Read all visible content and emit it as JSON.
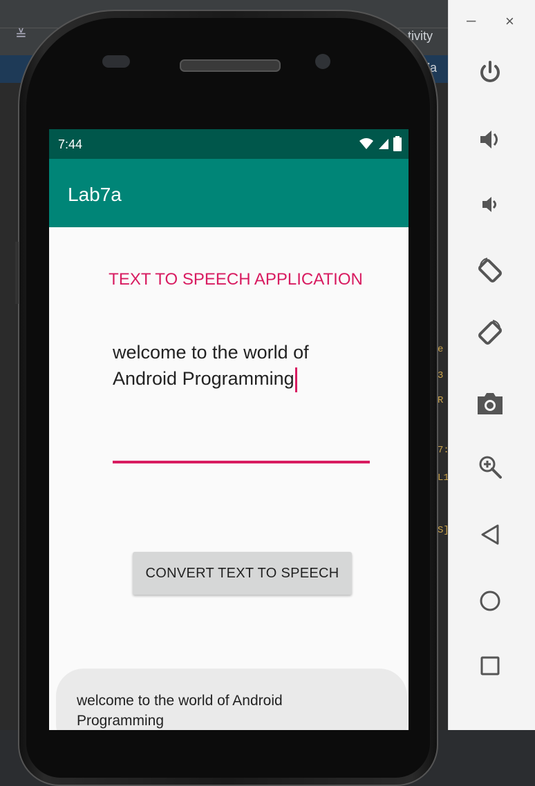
{
  "ide": {
    "tab_partial": "tivity",
    "tab_partial_2": "7a",
    "side_marks": [
      "e",
      "3",
      "R",
      "7:",
      "L1",
      "S]"
    ]
  },
  "status_bar": {
    "time": "7:44",
    "icons": [
      "wifi-icon",
      "signal-icon",
      "battery-icon"
    ]
  },
  "app_bar": {
    "title": "Lab7a"
  },
  "main": {
    "heading": "TEXT TO SPEECH APPLICATION",
    "edit_text_value": "welcome to the world of Android Programming",
    "convert_button_label": "CONVERT TEXT TO SPEECH"
  },
  "toast": {
    "message": "welcome to the world of Android Programming"
  },
  "emulator_toolbar": {
    "minimize_label": "–",
    "close_label": "×",
    "buttons": [
      "power-icon",
      "volume-up-icon",
      "volume-down-icon",
      "rotate-left-icon",
      "rotate-right-icon",
      "screenshot-icon",
      "zoom-icon",
      "back-icon",
      "home-icon",
      "overview-icon"
    ]
  },
  "colors": {
    "status_bar": "#00574b",
    "app_bar": "#008577",
    "accent": "#d81b60",
    "button": "#d6d7d7"
  }
}
